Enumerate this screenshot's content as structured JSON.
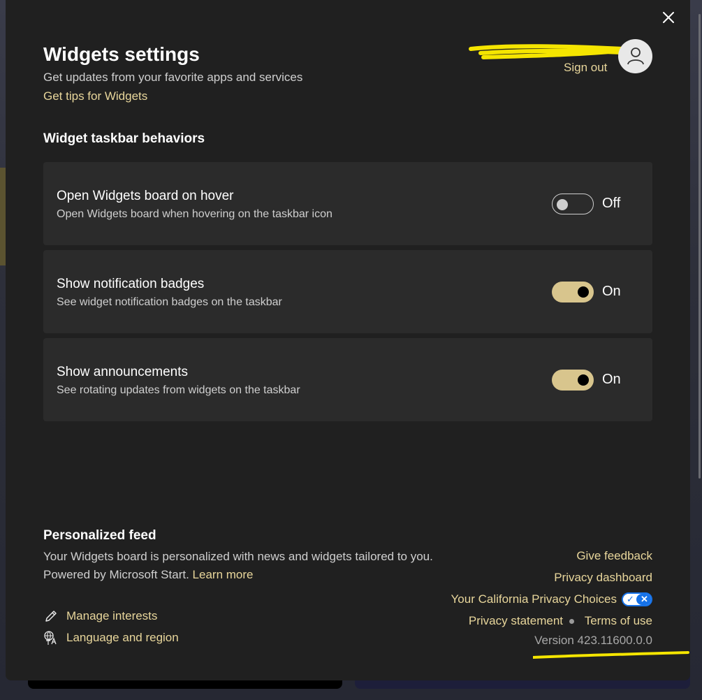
{
  "header": {
    "title": "Widgets settings",
    "subtitle": "Get updates from your favorite apps and services",
    "tips_link": "Get tips for Widgets",
    "account_name": "",
    "sign_out": "Sign out",
    "close_icon": "close-icon",
    "avatar_icon": "person-icon"
  },
  "taskbar": {
    "heading": "Widget taskbar behaviors",
    "settings": [
      {
        "title": "Open Widgets board on hover",
        "description": "Open Widgets board when hovering on the taskbar icon",
        "state": "Off"
      },
      {
        "title": "Show notification badges",
        "description": "See widget notification badges on the taskbar",
        "state": "On"
      },
      {
        "title": "Show announcements",
        "description": "See rotating updates from widgets on the taskbar",
        "state": "On"
      }
    ]
  },
  "feed": {
    "heading": "Personalized feed",
    "description": "Your Widgets board is personalized with news and widgets tailored to you. Powered by Microsoft Start.",
    "learn_more": "Learn more",
    "actions": [
      {
        "label": "Manage interests",
        "icon": "pencil-icon"
      },
      {
        "label": "Language and region",
        "icon": "language-icon"
      }
    ]
  },
  "footer": {
    "give_feedback": "Give feedback",
    "privacy_dashboard": "Privacy dashboard",
    "california_privacy": "Your California Privacy Choices",
    "privacy_statement": "Privacy statement",
    "terms_of_use": "Terms of use",
    "version": "Version 423.11600.0.0"
  },
  "colors": {
    "panel_background": "#202020",
    "card_background": "#2b2b2b",
    "accent": "#d8c58d",
    "link": "#e8d69b",
    "privacy_blue": "#1672e8",
    "highlight_marker": "#f5e500"
  }
}
